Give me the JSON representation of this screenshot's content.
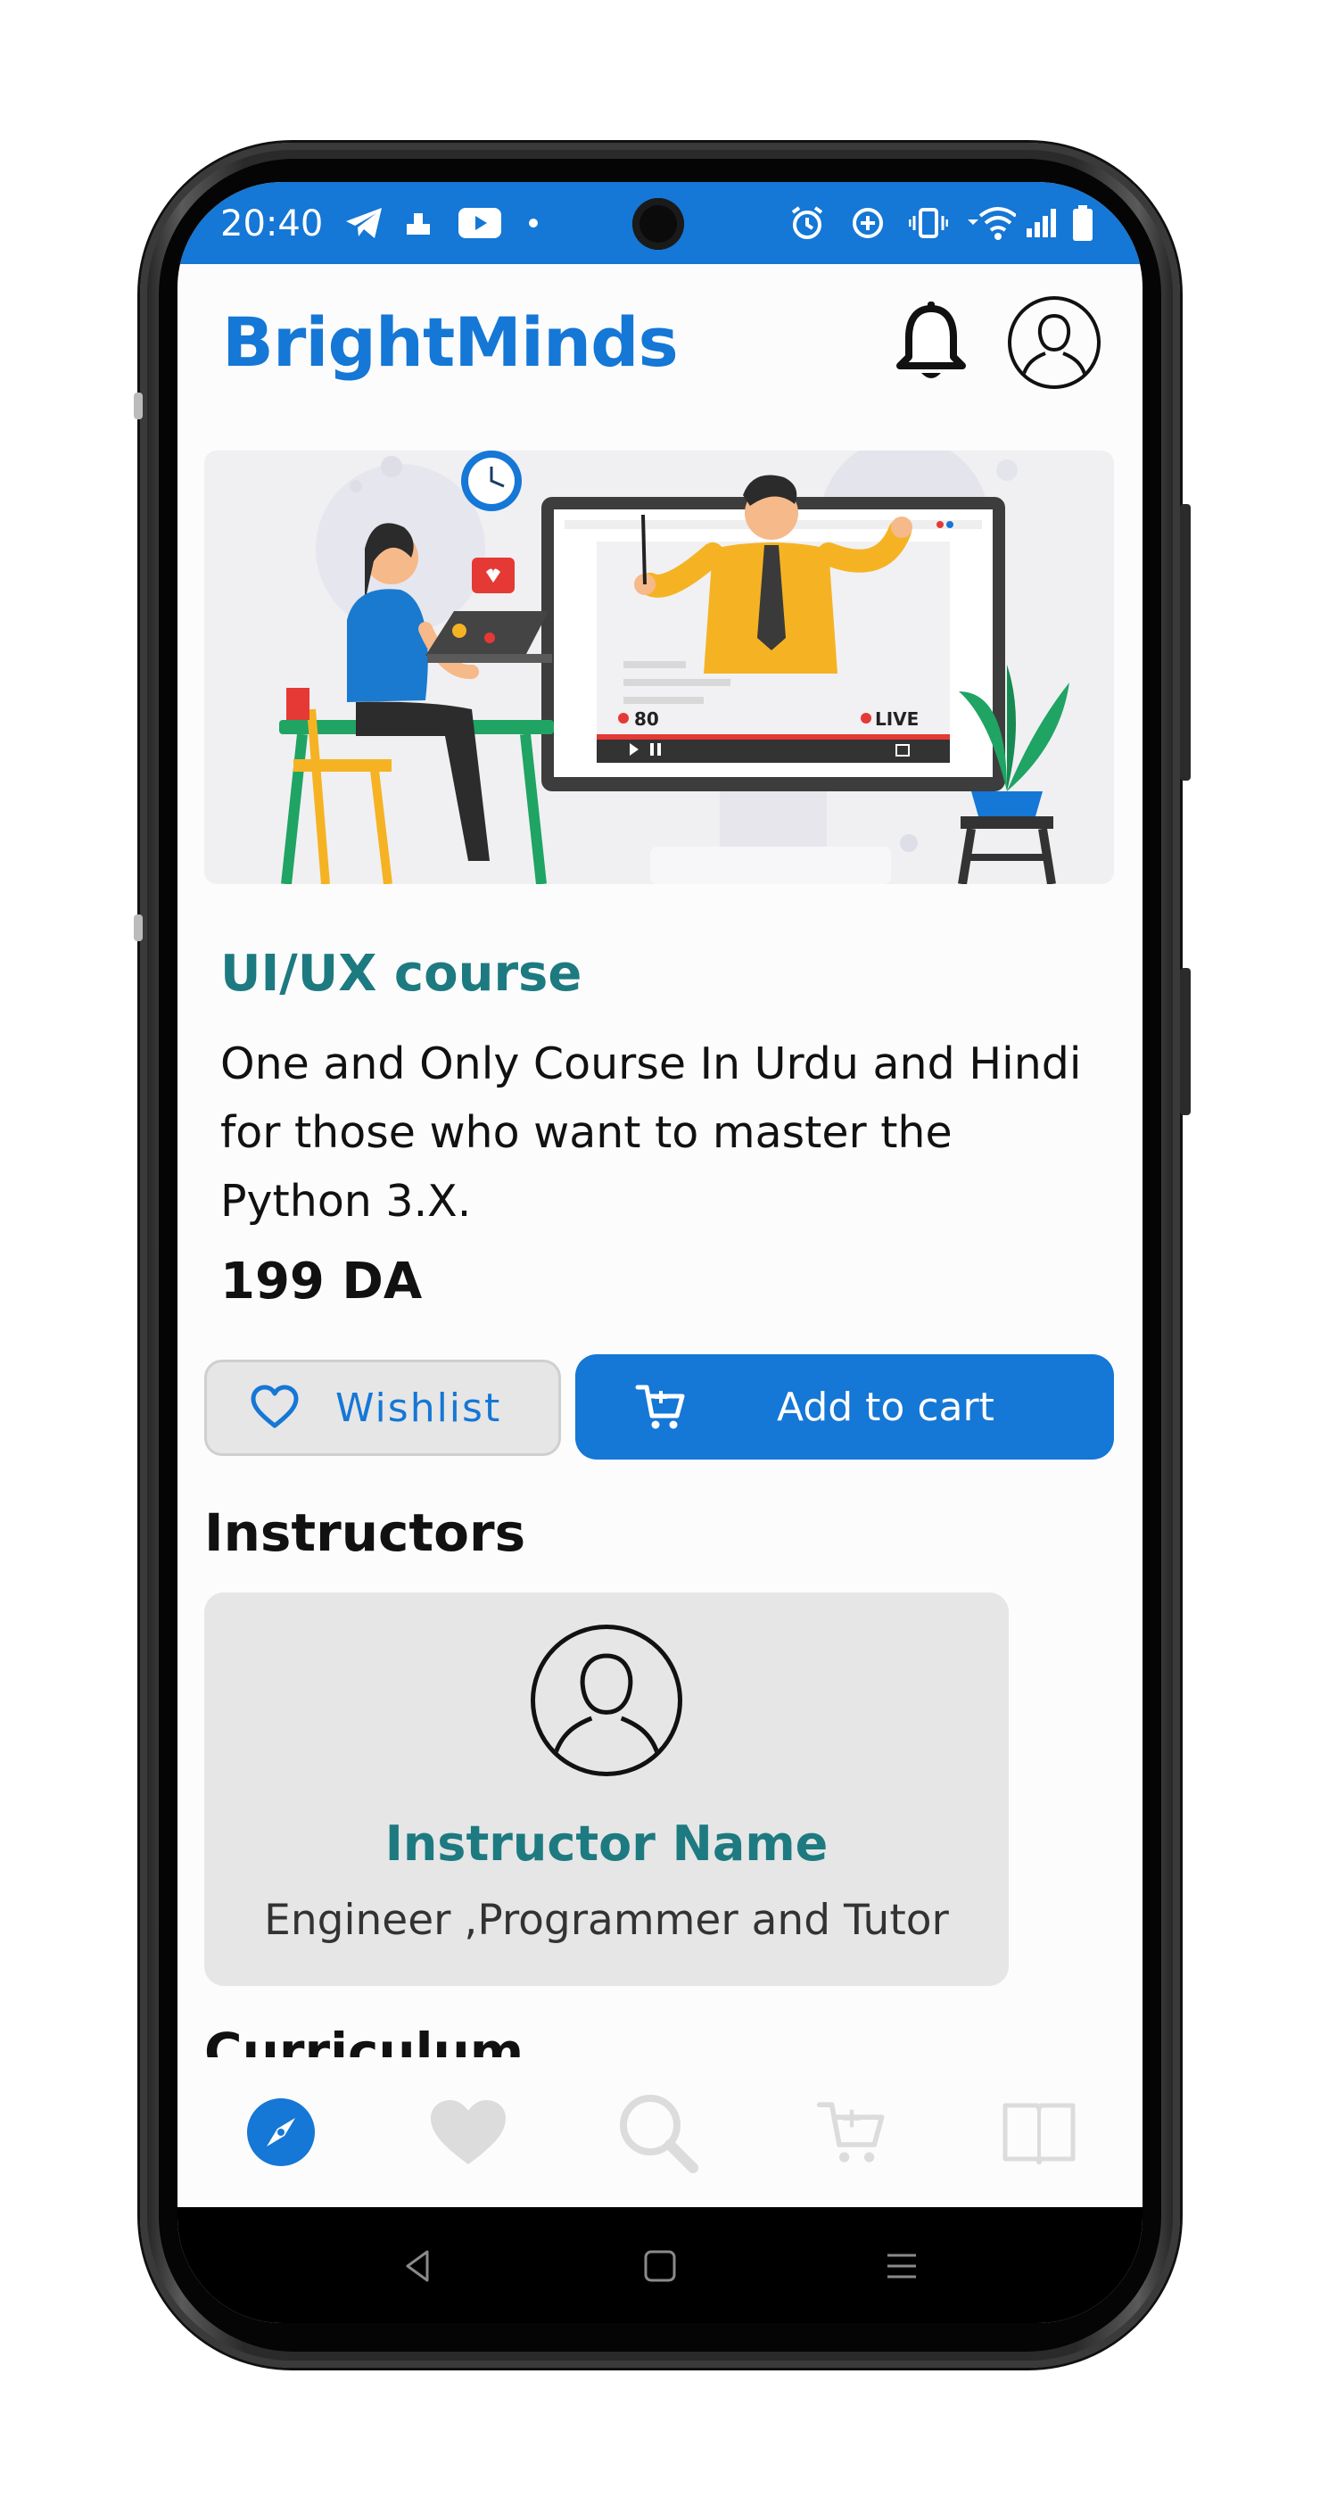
{
  "status_bar": {
    "time": "20:40",
    "left_icons": [
      "telegram-icon",
      "app-icon",
      "youtube-icon",
      "dot-icon"
    ],
    "right_icons": [
      "alarm-icon",
      "data-saver-icon",
      "vibrate-icon",
      "wifi-icon",
      "signal-icon",
      "battery-icon"
    ]
  },
  "header": {
    "app_name": "BrightMinds",
    "notification_icon": "bell-icon",
    "profile_icon": "user-icon"
  },
  "hero": {
    "live_badge": "LIVE",
    "viewer_count": "80"
  },
  "course": {
    "title": "UI/UX course",
    "description": "One and Only Course In Urdu and Hindi for those who want to master the Python 3.X.",
    "price": "199 DA"
  },
  "actions": {
    "wishlist_label": "Wishlist",
    "add_to_cart_label": "Add to cart"
  },
  "instructors": {
    "heading": "Instructors",
    "items": [
      {
        "name": "Instructor Name",
        "role": "Engineer ,Programmer and Tutor"
      }
    ]
  },
  "curriculum": {
    "heading": "Curriculum"
  },
  "bottom_nav": {
    "items": [
      {
        "icon": "compass-icon",
        "active": true
      },
      {
        "icon": "heart-icon",
        "active": false
      },
      {
        "icon": "search-icon",
        "active": false
      },
      {
        "icon": "cart-icon",
        "active": false
      },
      {
        "icon": "book-icon",
        "active": false
      }
    ]
  },
  "colors": {
    "brand": "#1577d6",
    "teal": "#1d7a80",
    "card": "#e6e6e6"
  }
}
